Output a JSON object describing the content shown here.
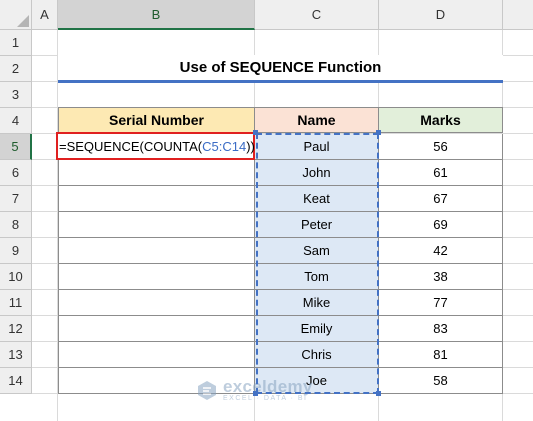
{
  "columns": [
    "A",
    "B",
    "C",
    "D"
  ],
  "rows": [
    "1",
    "2",
    "3",
    "4",
    "5",
    "6",
    "7",
    "8",
    "9",
    "10",
    "11",
    "12",
    "13",
    "14"
  ],
  "title": "Use of SEQUENCE Function",
  "table": {
    "headers": [
      "Serial Number",
      "Name",
      "Marks"
    ],
    "names": [
      "Paul",
      "John",
      "Keat",
      "Peter",
      "Sam",
      "Tom",
      "Mike",
      "Emily",
      "Chris",
      "Joe"
    ],
    "marks": [
      "56",
      "61",
      "67",
      "69",
      "42",
      "38",
      "77",
      "83",
      "81",
      "58"
    ]
  },
  "formula": {
    "prefix": "=SEQUENCE(COUNTA(",
    "ref": "C5:C14",
    "suffix": "))"
  },
  "watermark": {
    "name": "exceldemy",
    "subtitle": "EXCEL · DATA · BI"
  },
  "colors": {
    "range_highlight": "#4472c4",
    "formula_border": "#e02020",
    "header_serial": "#fde9b3",
    "header_name": "#fbe2d5",
    "header_marks": "#e2efda"
  }
}
